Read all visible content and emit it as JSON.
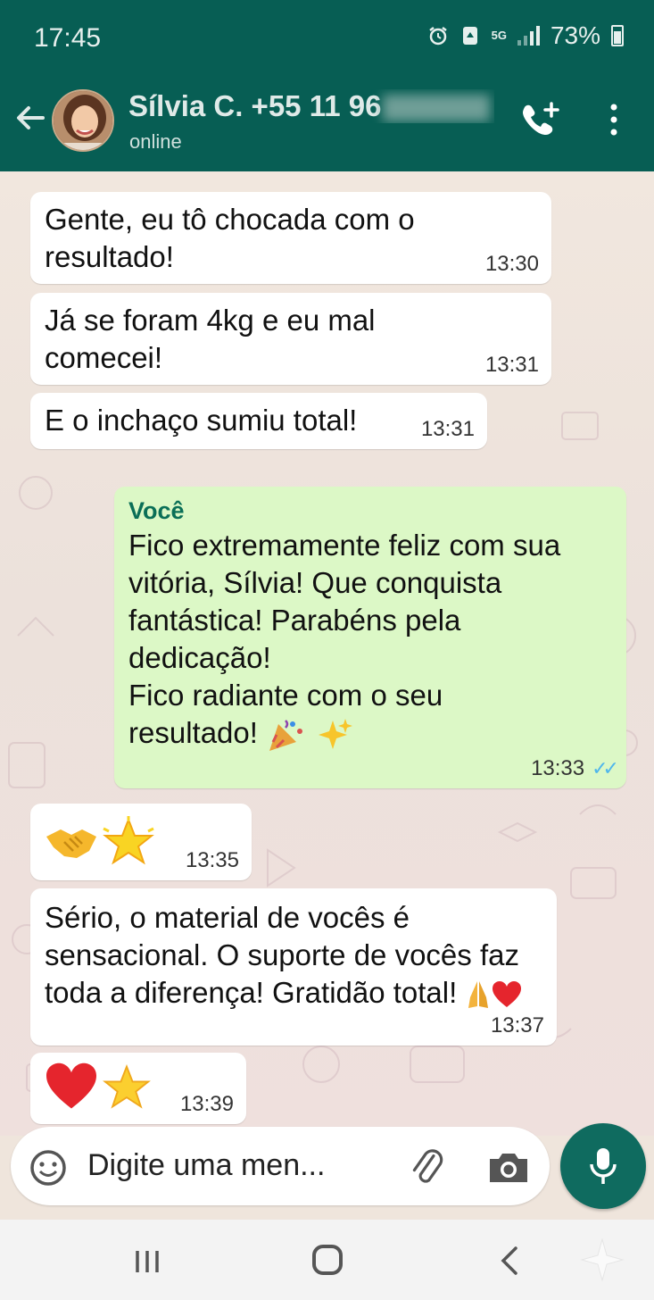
{
  "status_bar": {
    "time": "17:45",
    "network": "5G",
    "battery": "73%",
    "battery_level": 0.73
  },
  "header": {
    "contact_name": "Sílvia C. +55 11 96",
    "status": "online",
    "icons": [
      "back-arrow-icon",
      "avatar",
      "add-call-icon",
      "more-options-icon"
    ]
  },
  "messages": [
    {
      "direction": "incoming",
      "text": "Gente, eu tô chocada com o resultado!",
      "time": "13:30"
    },
    {
      "direction": "incoming",
      "text": "Já se foram 4kg e eu mal comecei!",
      "time": "13:31"
    },
    {
      "direction": "incoming",
      "text": "E o inchaço sumiu total!",
      "time": "13:31"
    },
    {
      "direction": "outgoing",
      "sender": "Você",
      "text_lines": [
        "Fico extremamente feliz com sua",
        "vitória, Sílvia! Que conquista",
        "fantástica! Parabéns pela",
        "dedicação!",
        "Fico radiante com o seu",
        "resultado!"
      ],
      "time": "13:33",
      "status": "read"
    },
    {
      "direction": "incoming",
      "emojis": [
        "handshake",
        "glowing-star"
      ],
      "time": "13:35"
    },
    {
      "direction": "incoming",
      "text_lines": [
        "Sério, o material de vocês é",
        "sensacional. O suporte de vocês faz",
        "toda a diferença! Gratidão total!"
      ],
      "time": "13:37"
    },
    {
      "direction": "incoming",
      "emojis": [
        "red-heart",
        "star"
      ],
      "time": "13:39"
    }
  ],
  "input": {
    "placeholder": "Digite uma men..."
  },
  "colors": {
    "header": "#075e54",
    "outgoing_bubble": "#dcf8c6",
    "incoming_bubble": "#ffffff",
    "read_ticks": "#4fb6ec",
    "mic_button": "#0f6b5f"
  }
}
